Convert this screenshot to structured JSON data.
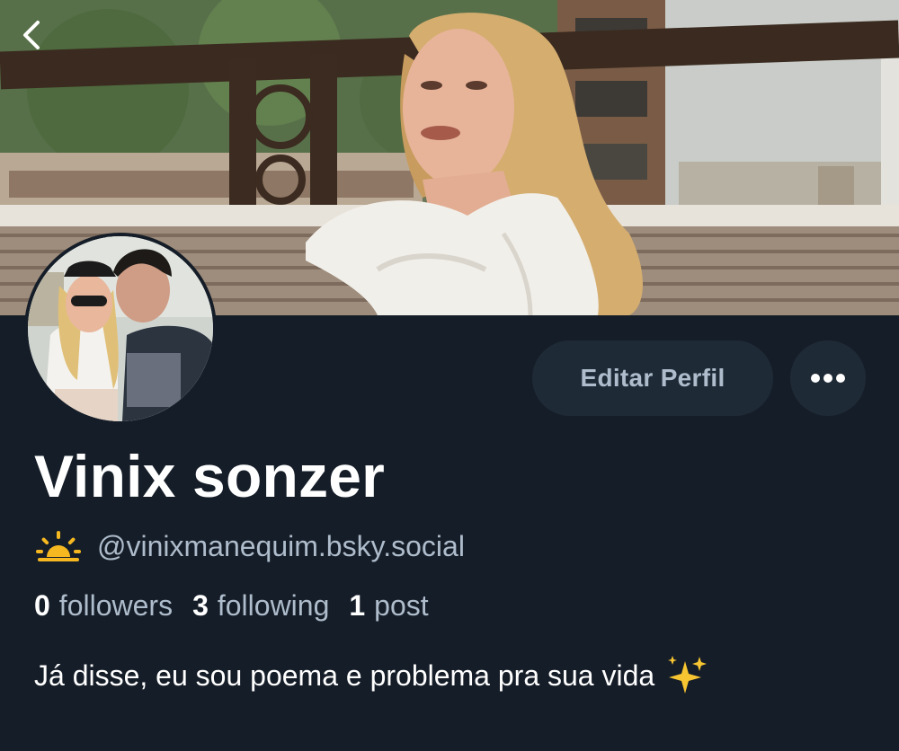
{
  "profile": {
    "display_name": "Vinix sonzer",
    "handle": "@vinixmanequim.bsky.social",
    "handle_emoji": "sunrise-emoji",
    "bio": "Já disse, eu sou poema e problema pra sua vida",
    "bio_emoji": "sparkles-emoji"
  },
  "stats": {
    "followers_count": "0",
    "followers_label": "followers",
    "following_count": "3",
    "following_label": "following",
    "posts_count": "1",
    "posts_label": "post"
  },
  "actions": {
    "edit_label": "Editar Perfil",
    "more_icon": "ellipsis-icon",
    "back_icon": "chevron-left-icon"
  },
  "colors": {
    "background": "#151d28",
    "button_bg": "#1f2a37",
    "muted_text": "#aebccb",
    "primary_text": "#ffffff"
  }
}
